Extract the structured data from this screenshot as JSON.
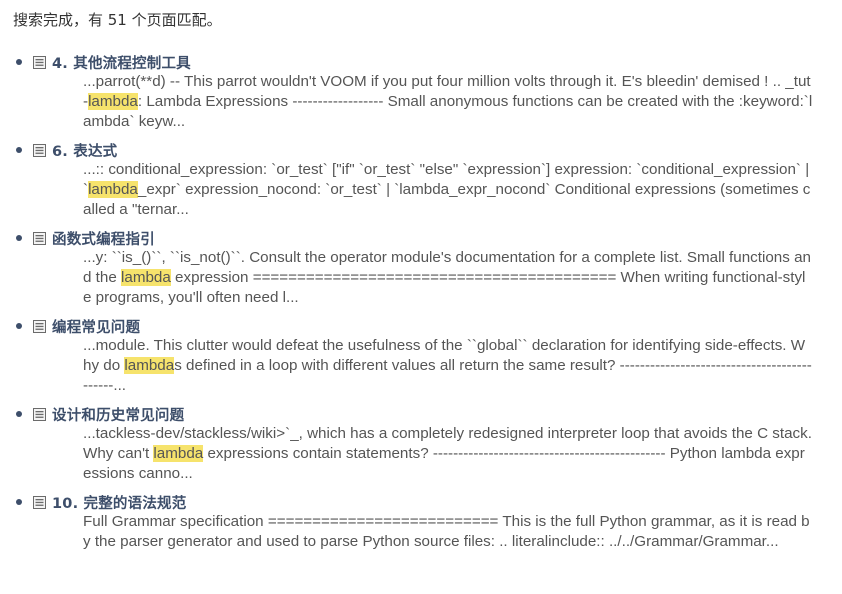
{
  "summary": "搜索完成，有 51 个页面匹配。",
  "highlight_color": "#f6e36c",
  "link_color": "#3d4e6a",
  "results": [
    {
      "title": "4. 其他流程控制工具",
      "icon": "document-icon",
      "context": [
        {
          "text": "...parrot(**d) -- This parrot wouldn't VOOM if you put four million volts through it. E's bleedin' demised ! .. _tut-"
        },
        {
          "text": "lambda",
          "highlight": true
        },
        {
          "text": ": Lambda Expressions ------------------ Small anonymous functions can be created with the :keyword:`lambda` keyw..."
        }
      ]
    },
    {
      "title": "6. 表达式",
      "icon": "document-icon",
      "context": [
        {
          "text": "...:: conditional_expression: `or_test` [\"if\" `or_test` \"else\" `expression`] expression: `conditional_expression` | `"
        },
        {
          "text": "lambda",
          "highlight": true
        },
        {
          "text": "_expr` expression_nocond: `or_test` | `lambda_expr_nocond` Conditional expressions (sometimes called a \"ternar..."
        }
      ]
    },
    {
      "title": "函数式编程指引",
      "icon": "document-icon",
      "context": [
        {
          "text": "...y: ``is_()``, ``is_not()``. Consult the operator module's documentation for a complete list. Small functions and the "
        },
        {
          "text": "lambda",
          "highlight": true
        },
        {
          "text": " expression ========================================= When writing functional-style programs, you'll often need l..."
        }
      ]
    },
    {
      "title": "编程常见问题",
      "icon": "document-icon",
      "context": [
        {
          "text": "...module. This clutter would defeat the usefulness of the ``global`` declaration for identifying side-effects. Why do "
        },
        {
          "text": "lambda",
          "highlight": true
        },
        {
          "text": "s defined in a loop with different values all return the same result? --------------------------------------------..."
        }
      ]
    },
    {
      "title": "设计和历史常见问题",
      "icon": "document-icon",
      "context": [
        {
          "text": "...tackless-dev/stackless/wiki>`_, which has a completely redesigned interpreter loop that avoids the C stack. Why can't "
        },
        {
          "text": "lambda",
          "highlight": true
        },
        {
          "text": " expressions contain statements? ---------------------------------------------- Python lambda expressions canno..."
        }
      ]
    },
    {
      "title": "10. 完整的语法规范",
      "icon": "document-icon",
      "context": [
        {
          "text": "Full Grammar specification ========================== This is the full Python grammar, as it is read by the parser generator and used to parse Python source files: .. literalinclude:: ../../Grammar/Grammar..."
        }
      ]
    }
  ]
}
